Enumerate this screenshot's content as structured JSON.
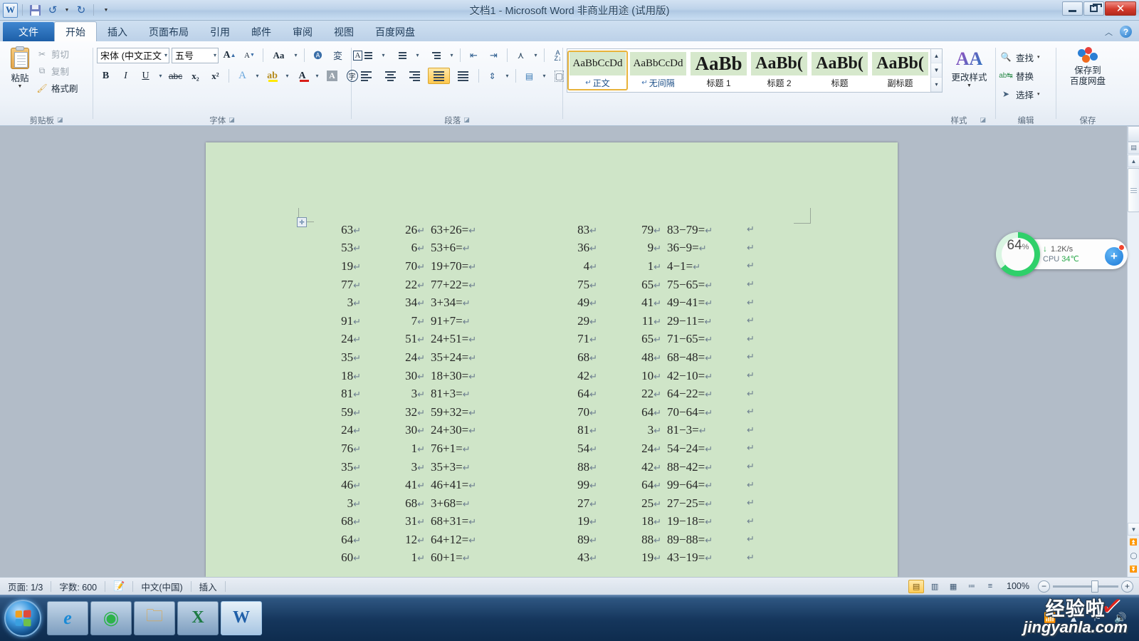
{
  "titlebar": {
    "document_title": "文档1  -  Microsoft Word 非商业用途 (试用版)",
    "qat": {
      "logo": "W",
      "save_label": "save-icon",
      "undo_label": "undo-icon",
      "redo_label": "redo-icon",
      "customize_label": "customize-qat-icon"
    },
    "controls": {
      "minimize": "",
      "restore": "",
      "close": "✕"
    }
  },
  "tabs": [
    {
      "label": "文件",
      "id": "file"
    },
    {
      "label": "开始",
      "id": "home"
    },
    {
      "label": "插入",
      "id": "insert"
    },
    {
      "label": "页面布局",
      "id": "layout"
    },
    {
      "label": "引用",
      "id": "references"
    },
    {
      "label": "邮件",
      "id": "mailings"
    },
    {
      "label": "审阅",
      "id": "review"
    },
    {
      "label": "视图",
      "id": "view"
    },
    {
      "label": "百度网盘",
      "id": "baidu"
    }
  ],
  "ribbon": {
    "clipboard": {
      "group_label": "剪贴板",
      "paste_label": "粘贴",
      "cut_label": "剪切",
      "copy_label": "复制",
      "format_painter_label": "格式刷"
    },
    "font": {
      "group_label": "字体",
      "font_name": "宋体 (中文正文",
      "font_size": "五号",
      "grow_label": "A",
      "shrink_label": "A",
      "change_case_label": "Aa",
      "bold_label": "B",
      "italic_label": "I",
      "underline_label": "U",
      "strike_label": "abc",
      "subscript_label": "x₂",
      "superscript_label": "x²",
      "text_effects_label": "A",
      "highlight_label": "ab",
      "font_color_label": "A",
      "char_shading_label": "A",
      "enclose_label": "字"
    },
    "paragraph": {
      "group_label": "段落",
      "bullets_label": "bullet-list-icon",
      "numbering_label": "numbered-list-icon",
      "multilevel_label": "multilevel-list-icon",
      "decrease_indent_label": "decrease-indent-icon",
      "increase_indent_label": "increase-indent-icon",
      "asian_layout_label": "asian-layout-icon",
      "sort_label": "A\nZ",
      "show_marks_label": "¶",
      "align_left_label": "align-left-icon",
      "align_center_label": "align-center-icon",
      "align_right_label": "align-right-icon",
      "justify_label": "justify-icon",
      "distribute_label": "distribute-icon",
      "line_spacing_label": "line-spacing-icon",
      "shading_label": "shading-icon",
      "borders_label": "borders-icon"
    },
    "styles": {
      "group_label": "样式",
      "items": [
        {
          "preview": "AaBbCcDd",
          "name": "正文",
          "has_pilcrow": true,
          "size": 15,
          "selected": true
        },
        {
          "preview": "AaBbCcDd",
          "name": "无间隔",
          "has_pilcrow": true,
          "size": 15,
          "selected": false
        },
        {
          "preview": "AaBb",
          "name": "标题 1",
          "has_pilcrow": false,
          "size": 27,
          "selected": false
        },
        {
          "preview": "AaBb(",
          "name": "标题 2",
          "has_pilcrow": false,
          "size": 24,
          "selected": false
        },
        {
          "preview": "AaBb(",
          "name": "标题",
          "has_pilcrow": false,
          "size": 24,
          "selected": false
        },
        {
          "preview": "AaBb(",
          "name": "副标题",
          "has_pilcrow": false,
          "size": 24,
          "selected": false
        }
      ],
      "change_styles_label": "更改样式"
    },
    "editing": {
      "group_label": "编辑",
      "find_label": "查找",
      "replace_label": "替换",
      "select_label": "选择"
    },
    "save_group": {
      "group_label": "保存",
      "baidu_line1": "保存到",
      "baidu_line2": "百度网盘"
    }
  },
  "document": {
    "pilcrow": "↵",
    "rows": [
      {
        "a": "63",
        "b": "26",
        "c": "63+26=",
        "d": "83",
        "e": "79",
        "f": "83−79="
      },
      {
        "a": "53",
        "b": "6",
        "c": "53+6=",
        "d": "36",
        "e": "9",
        "f": "36−9="
      },
      {
        "a": "19",
        "b": "70",
        "c": "19+70=",
        "d": "4",
        "e": "1",
        "f": "4−1="
      },
      {
        "a": "77",
        "b": "22",
        "c": "77+22=",
        "d": "75",
        "e": "65",
        "f": "75−65="
      },
      {
        "a": "3",
        "b": "34",
        "c": "3+34=",
        "d": "49",
        "e": "41",
        "f": "49−41="
      },
      {
        "a": "91",
        "b": "7",
        "c": "91+7=",
        "d": "29",
        "e": "11",
        "f": "29−11="
      },
      {
        "a": "24",
        "b": "51",
        "c": "24+51=",
        "d": "71",
        "e": "65",
        "f": "71−65="
      },
      {
        "a": "35",
        "b": "24",
        "c": "35+24=",
        "d": "68",
        "e": "48",
        "f": "68−48="
      },
      {
        "a": "18",
        "b": "30",
        "c": "18+30=",
        "d": "42",
        "e": "10",
        "f": "42−10="
      },
      {
        "a": "81",
        "b": "3",
        "c": "81+3=",
        "d": "64",
        "e": "22",
        "f": "64−22="
      },
      {
        "a": "59",
        "b": "32",
        "c": "59+32=",
        "d": "70",
        "e": "64",
        "f": "70−64="
      },
      {
        "a": "24",
        "b": "30",
        "c": "24+30=",
        "d": "81",
        "e": "3",
        "f": "81−3="
      },
      {
        "a": "76",
        "b": "1",
        "c": "76+1=",
        "d": "54",
        "e": "24",
        "f": "54−24="
      },
      {
        "a": "35",
        "b": "3",
        "c": "35+3=",
        "d": "88",
        "e": "42",
        "f": "88−42="
      },
      {
        "a": "46",
        "b": "41",
        "c": "46+41=",
        "d": "99",
        "e": "64",
        "f": "99−64="
      },
      {
        "a": "3",
        "b": "68",
        "c": "3+68=",
        "d": "27",
        "e": "25",
        "f": "27−25="
      },
      {
        "a": "68",
        "b": "31",
        "c": "68+31=",
        "d": "19",
        "e": "18",
        "f": "19−18="
      },
      {
        "a": "64",
        "b": "12",
        "c": "64+12=",
        "d": "89",
        "e": "88",
        "f": "89−88="
      },
      {
        "a": "60",
        "b": "1",
        "c": "60+1=",
        "d": "43",
        "e": "19",
        "f": "43−19="
      }
    ]
  },
  "statusbar": {
    "page": "页面: 1/3",
    "words": "字数: 600",
    "proofing": "spell-check-icon",
    "language": "中文(中国)",
    "insert_mode": "插入",
    "zoom": "100%",
    "zoom_out": "−",
    "zoom_in": "+",
    "views": [
      "print-layout-view",
      "full-screen-view",
      "web-layout-view",
      "outline-view",
      "draft-view"
    ]
  },
  "float_widget": {
    "percent": "64",
    "percent_symbol": "%",
    "net_speed": "1.2K/s",
    "down_arrow": "↓",
    "cpu_label": "CPU",
    "cpu_temp": "34℃",
    "plus": "+",
    "ring_color": "#2fd06a"
  },
  "taskbar": {
    "start_label": "start-orb",
    "items": [
      {
        "name": "internet-explorer",
        "glyph": "e"
      },
      {
        "name": "network-app",
        "glyph": "◉"
      },
      {
        "name": "windows-explorer",
        "glyph": "▤"
      },
      {
        "name": "microsoft-excel",
        "glyph": "X"
      },
      {
        "name": "microsoft-word",
        "glyph": "W"
      }
    ],
    "tray": [
      "wifi-icon",
      "show-hidden-icons",
      "action-center-flag",
      "volume-icon"
    ]
  },
  "watermark": {
    "chinese": "经验啦",
    "domain": "jingyanla.com",
    "check": "✓"
  },
  "colors": {
    "page_background": "#cfe5c8",
    "accent_blue": "#1d5fa8",
    "highlight_orange": "#ffc84d",
    "green": "#2fd06a"
  }
}
